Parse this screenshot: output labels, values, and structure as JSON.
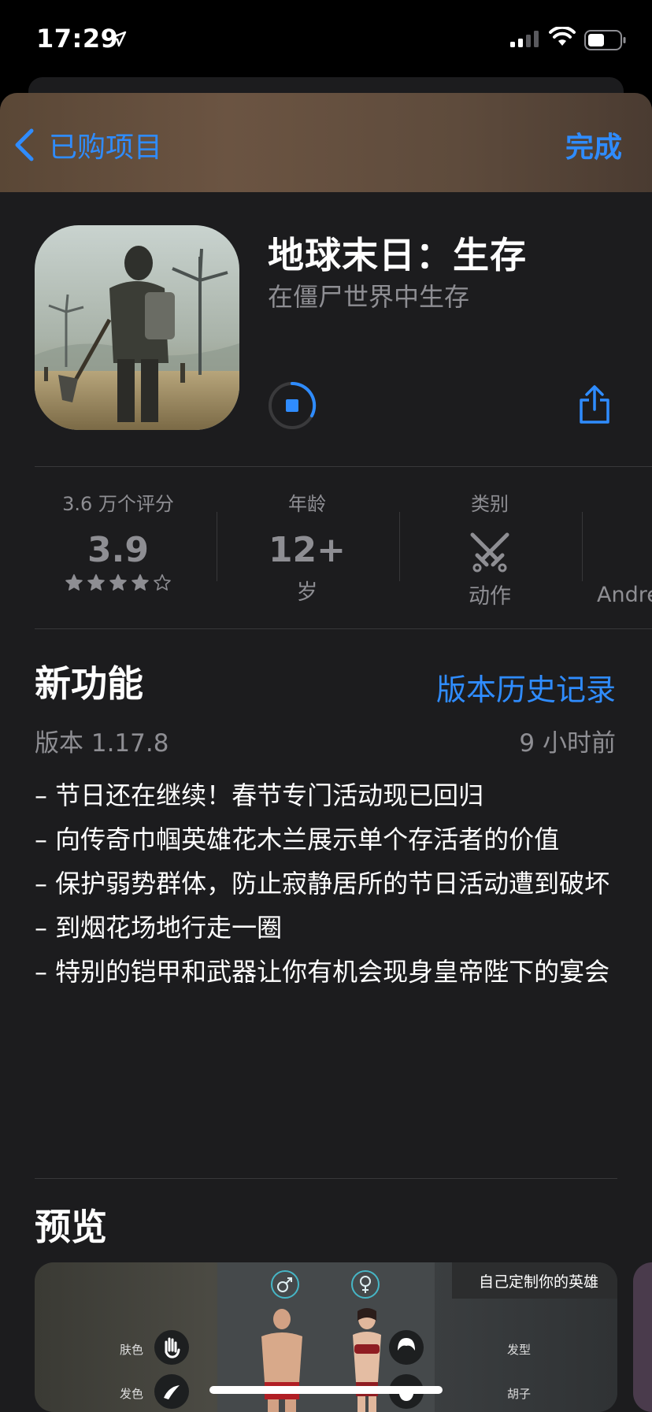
{
  "status": {
    "time": "17:29"
  },
  "nav": {
    "back_label": "已购项目",
    "done_label": "完成"
  },
  "app": {
    "name": "地球末日：生存",
    "subtitle": "在僵尸世界中生存"
  },
  "stats": [
    {
      "caption": "3.6 万个评分",
      "value": "3.9",
      "stars_filled": 4,
      "stars_total": 5
    },
    {
      "caption": "年龄",
      "value": "12+",
      "sub": "岁"
    },
    {
      "caption": "类别",
      "icon": "crossed-swords-icon",
      "sub": "动作"
    },
    {
      "sub": "Andre"
    }
  ],
  "whats_new": {
    "title": "新功能",
    "history_link": "版本历史记录",
    "version": "版本 1.17.8",
    "time_ago": "9 小时前",
    "notes": [
      "– 节日还在继续！春节专门活动现已回归",
      "– 向传奇巾帼英雄花木兰展示单个存活者的价值",
      "– 保护弱势群体，防止寂静居所的节日活动遭到破坏",
      "– 到烟花场地行走一圈",
      "– 特别的铠甲和武器让你有机会现身皇帝陛下的宴会"
    ]
  },
  "preview": {
    "title": "预览",
    "banner": "自己定制你的英雄",
    "labels": {
      "skin": "肤色",
      "hair_color": "发色",
      "hairstyle": "发型",
      "beard": "胡子"
    }
  },
  "colors": {
    "accent": "#2f8cff",
    "background": "#1c1c1e",
    "secondary_text": "#8e8e93"
  }
}
